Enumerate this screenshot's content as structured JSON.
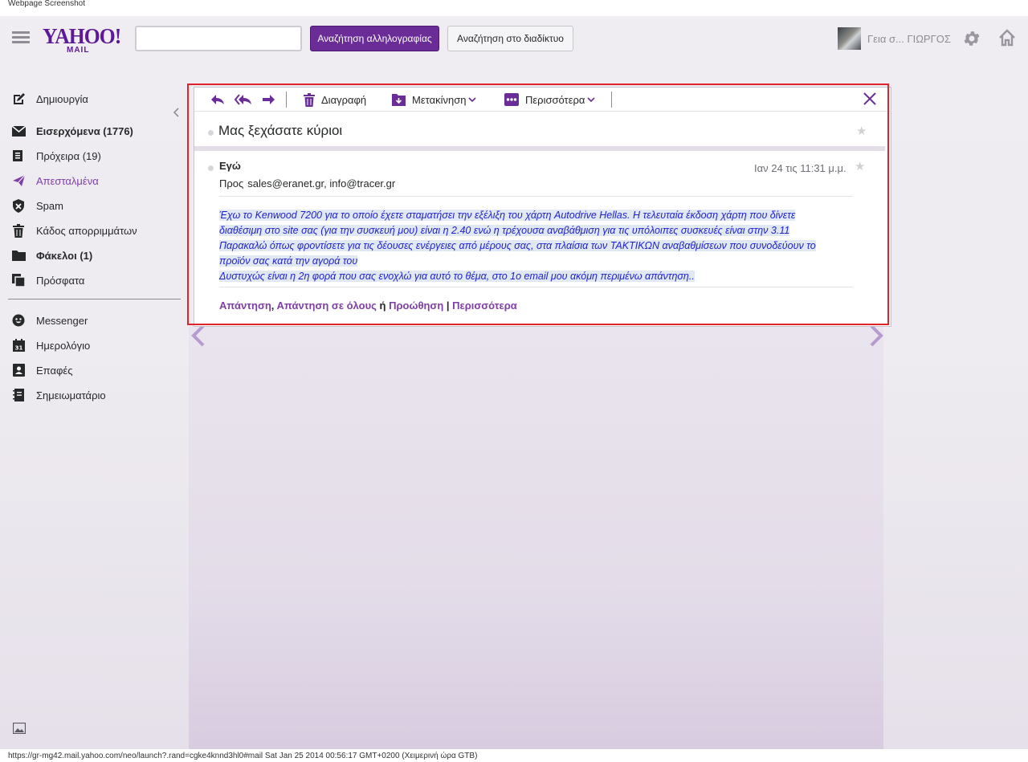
{
  "captions": {
    "top": "Webpage Screenshot",
    "bottom": "https://gr-mg42.mail.yahoo.com/neo/launch?.rand=cgke4knnd3hl0#mail Sat Jan 25 2014 00:56:17 GMT+0200 (Χειμερινή ώρα GTB)"
  },
  "header": {
    "logo_main": "YAHOO!",
    "logo_sub": "MAIL",
    "search_value": "",
    "search_mail_label": "Αναζήτηση αλληλογραφίας",
    "search_web_label": "Αναζήτηση στο διαδίκτυο",
    "greeting": "Γεια σ...  ΓΙΩΡΓΟΣ",
    "icons": [
      "menu-icon",
      "settings-gear-icon",
      "home-icon",
      "avatar"
    ]
  },
  "sidebar": {
    "compose": "Δημιουργία",
    "folders": [
      {
        "label": "Εισερχόμενα (1776)",
        "icon": "envelope-icon",
        "bold": true
      },
      {
        "label": "Πρόχειρα (19)",
        "icon": "drafts-icon"
      },
      {
        "label": "Απεσταλμένα",
        "icon": "paper-plane-icon",
        "active": true
      },
      {
        "label": "Spam",
        "icon": "shield-icon"
      },
      {
        "label": "Κάδος απορριμμάτων",
        "icon": "trash-icon"
      },
      {
        "label": "Φάκελοι (1)",
        "icon": "folder-icon",
        "bold": true
      },
      {
        "label": "Πρόσφατα",
        "icon": "recent-icon"
      }
    ],
    "apps": [
      {
        "label": "Messenger",
        "icon": "messenger-icon"
      },
      {
        "label": "Ημερολόγιο",
        "icon": "calendar-icon"
      },
      {
        "label": "Επαφές",
        "icon": "contacts-icon"
      },
      {
        "label": "Σημειωματάριο",
        "icon": "notepad-icon"
      }
    ]
  },
  "toolbar": {
    "delete_label": "Διαγραφή",
    "move_label": "Μετακίνηση",
    "more_label": "Περισσότερα"
  },
  "message": {
    "subject": "Μας ξεχάσατε κύριοι",
    "from": "Εγώ",
    "date": "Ιαν 24 τις 11:31 μ.μ.",
    "to_label": "Προς",
    "to": "sales@eranet.gr, info@tracer.gr",
    "body_lines": [
      "Έχω το Kenwood 7200 για το οποίο έχετε σταματήσει την εξέλιξη του χάρτη Autodrive Hellas. Η τελευταία έκδοση χάρτη που δίνετε",
      "διαθέσιμη στο site σας (για την συσκευή μου) είναι η 2.40 ενώ η τρέχουσα αναβάθμιση για τις υπόλοιπες συσκευές είναι στην 3.11",
      "Παρακαλώ όπως φροντίσετε για τις δέουσες ενέργειες από μέρους σας, στα πλαίσια των ΤΑΚΤΙΚΩΝ αναβαθμίσεων που συνοδεύουν το",
      "προϊόν σας κατά την αγορά του",
      "Δυστυχώς είναι η 2η φορά που σας ενοχλώ για αυτό το θέμα, στο 1ο email μου ακόμη περιμένω απάντηση.."
    ],
    "actions": {
      "reply": "Απάντηση",
      "comma": ",",
      "reply_all": "Απάντηση σε όλους",
      "or": "ή",
      "forward": "Προώθηση",
      "pipe": "|",
      "more": "Περισσότερα"
    }
  },
  "colors": {
    "brand": "#5e1a96",
    "accent_link": "#7e3ea8",
    "body_text": "#1f1fd0",
    "highlight_frame": "#e0242d"
  }
}
